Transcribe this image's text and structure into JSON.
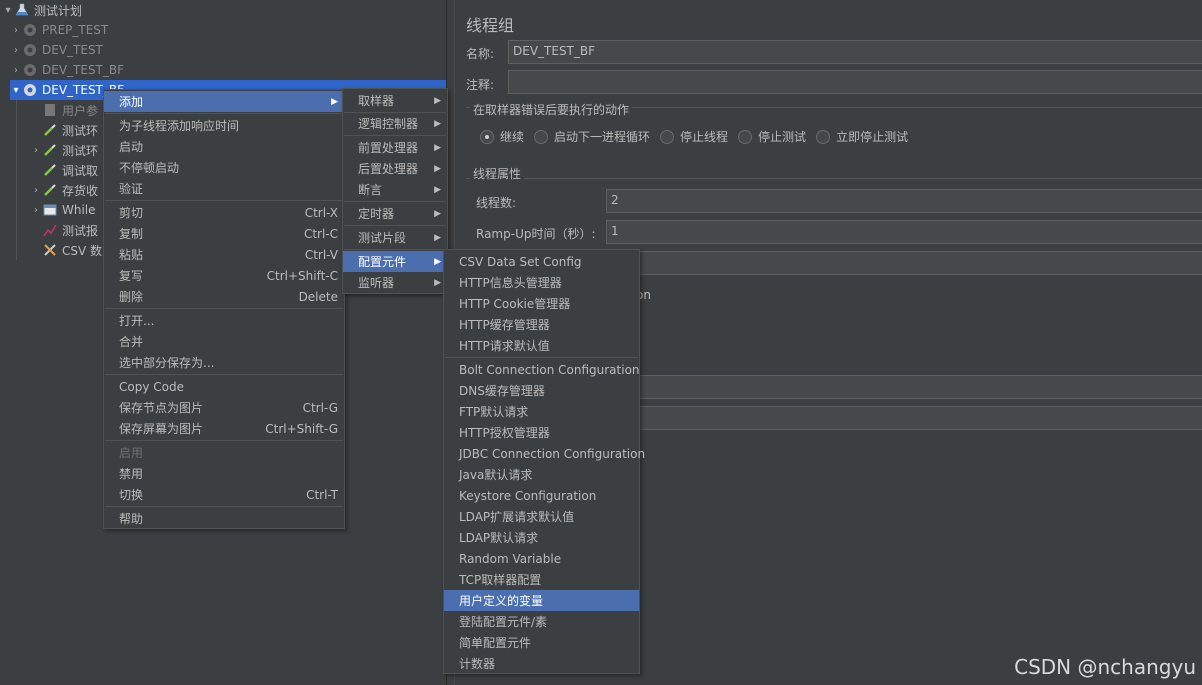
{
  "tree": {
    "root": "测试计划",
    "items": [
      {
        "label": "PREP_TEST"
      },
      {
        "label": "DEV_TEST"
      },
      {
        "label": "DEV_TEST_BF"
      },
      {
        "label": "DEV_TEST_BF"
      },
      {
        "label": "用户参"
      },
      {
        "label": "测试环"
      },
      {
        "label": "测试环"
      },
      {
        "label": "调试取"
      },
      {
        "label": "存货收"
      },
      {
        "label": "While"
      },
      {
        "label": "测试报"
      },
      {
        "label": "CSV 数"
      }
    ]
  },
  "panel": {
    "title": "线程组",
    "name_label": "名称:",
    "name_value": "DEV_TEST_BF",
    "comment_label": "注释:",
    "comment_value": "",
    "error_section": "在取样器错误后要执行的动作",
    "radios": [
      {
        "label": "继续",
        "checked": true
      },
      {
        "label": "启动下一进程循环",
        "checked": false
      },
      {
        "label": "停止线程",
        "checked": false
      },
      {
        "label": "停止测试",
        "checked": false
      },
      {
        "label": "立即停止测试",
        "checked": false
      }
    ],
    "thread_section": "线程属性",
    "threads_label": "线程数:",
    "threads_value": "2",
    "rampup_label": "Ramp-Up时间（秒）:",
    "rampup_value": "1",
    "partial_text": "on"
  },
  "context_menu": {
    "items": [
      {
        "label": "添加",
        "submenu": true,
        "highlighted": true
      },
      {
        "label": "为子线程添加响应时间"
      },
      {
        "label": "启动"
      },
      {
        "label": "不停顿启动"
      },
      {
        "label": "验证"
      },
      {
        "label": "剪切",
        "shortcut": "Ctrl-X"
      },
      {
        "label": "复制",
        "shortcut": "Ctrl-C"
      },
      {
        "label": "粘贴",
        "shortcut": "Ctrl-V"
      },
      {
        "label": "复写",
        "shortcut": "Ctrl+Shift-C"
      },
      {
        "label": "删除",
        "shortcut": "Delete"
      },
      {
        "label": "打开..."
      },
      {
        "label": "合并"
      },
      {
        "label": "选中部分保存为..."
      },
      {
        "label": "Copy Code"
      },
      {
        "label": "保存节点为图片",
        "shortcut": "Ctrl-G"
      },
      {
        "label": "保存屏幕为图片",
        "shortcut": "Ctrl+Shift-G"
      },
      {
        "label": "启用",
        "disabled": true
      },
      {
        "label": "禁用"
      },
      {
        "label": "切换",
        "shortcut": "Ctrl-T"
      },
      {
        "label": "帮助"
      }
    ]
  },
  "add_menu": {
    "items": [
      {
        "label": "取样器"
      },
      {
        "label": "逻辑控制器"
      },
      {
        "label": "前置处理器"
      },
      {
        "label": "后置处理器"
      },
      {
        "label": "断言"
      },
      {
        "label": "定时器"
      },
      {
        "label": "测试片段"
      },
      {
        "label": "配置元件",
        "highlighted": true
      },
      {
        "label": "监听器"
      }
    ]
  },
  "config_menu": {
    "items": [
      {
        "label": "CSV Data Set Config"
      },
      {
        "label": "HTTP信息头管理器"
      },
      {
        "label": "HTTP Cookie管理器"
      },
      {
        "label": "HTTP缓存管理器"
      },
      {
        "label": "HTTP请求默认值"
      },
      {
        "label": "Bolt Connection Configuration"
      },
      {
        "label": "DNS缓存管理器"
      },
      {
        "label": "FTP默认请求"
      },
      {
        "label": "HTTP授权管理器"
      },
      {
        "label": "JDBC Connection Configuration"
      },
      {
        "label": "Java默认请求"
      },
      {
        "label": "Keystore Configuration"
      },
      {
        "label": "LDAP扩展请求默认值"
      },
      {
        "label": "LDAP默认请求"
      },
      {
        "label": "Random Variable"
      },
      {
        "label": "TCP取样器配置"
      },
      {
        "label": "用户定义的变量",
        "highlighted": true
      },
      {
        "label": "登陆配置元件/素"
      },
      {
        "label": "简单配置元件"
      },
      {
        "label": "计数器"
      }
    ]
  },
  "watermark": "CSDN @nchangyu",
  "colors": {
    "background": "#3c3f41",
    "selection": "#2f65ca",
    "menu_highlight": "#4b6eaf"
  }
}
